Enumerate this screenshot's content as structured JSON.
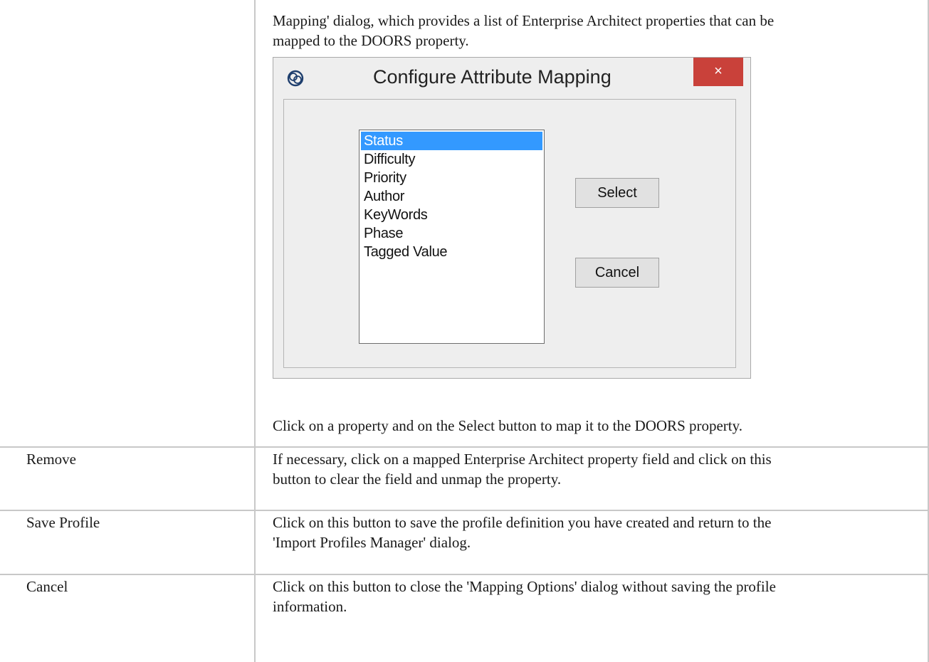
{
  "intro_text_line1": "Mapping' dialog, which provides a list of Enterprise Architect properties that can be",
  "intro_text_line2": "mapped to the DOORS property.",
  "dialog": {
    "title": "Configure Attribute Mapping",
    "close_glyph": "×",
    "list_items": [
      "Status",
      "Difficulty",
      "Priority",
      "Author",
      "KeyWords",
      "Phase",
      "Tagged Value"
    ],
    "selected_item": "Status",
    "select_label": "Select",
    "cancel_label": "Cancel",
    "close_color": "#c9413a",
    "selection_color": "#3399ff"
  },
  "after_dialog_text": "Click on a property and on the Select button to map it to the DOORS property.",
  "rows": [
    {
      "label": "Remove",
      "line1": "If necessary, click on a mapped Enterprise Architect property field and click on this",
      "line2": "button to clear the field and unmap the property."
    },
    {
      "label": "Save Profile",
      "line1": "Click on this button to save the profile definition you have created and return to the",
      "line2": "'Import Profiles Manager' dialog."
    },
    {
      "label": "Cancel",
      "line1": "Click on this button to close the 'Mapping Options' dialog without saving the profile",
      "line2": "information."
    }
  ]
}
